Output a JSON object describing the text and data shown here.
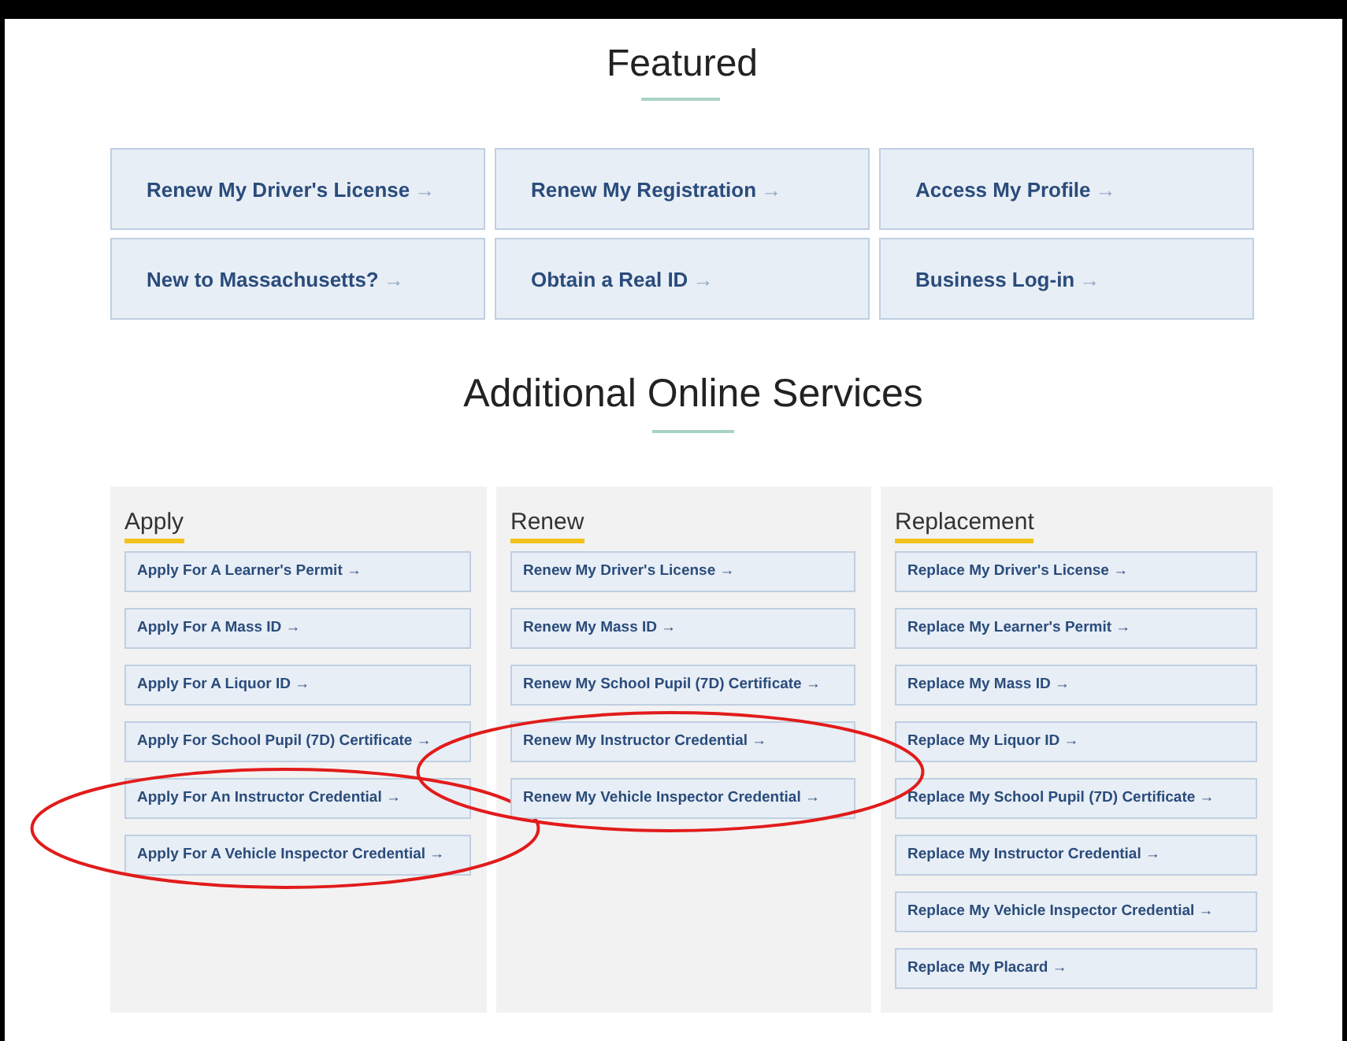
{
  "featured": {
    "title": "Featured",
    "links": [
      {
        "label": "Renew My Driver's License",
        "arrow": "→"
      },
      {
        "label": "Renew My Registration",
        "arrow": "→"
      },
      {
        "label": "Access My Profile",
        "arrow": "→"
      },
      {
        "label": "New to Massachusetts?",
        "arrow": "→"
      },
      {
        "label": "Obtain a Real ID",
        "arrow": "→"
      },
      {
        "label": "Business Log-in",
        "arrow": "→"
      }
    ]
  },
  "services": {
    "title": "Additional Online Services",
    "columns": [
      {
        "heading": "Apply",
        "links": [
          {
            "label": "Apply For A Learner's Permit →",
            "circled": false
          },
          {
            "label": "Apply For A Mass ID →",
            "circled": false
          },
          {
            "label": "Apply For A Liquor ID →",
            "circled": false
          },
          {
            "label": "Apply For School Pupil (7D) Certificate →",
            "circled": false
          },
          {
            "label": "Apply For An Instructor Credential →",
            "circled": true
          },
          {
            "label": "Apply For A Vehicle Inspector Credential →",
            "circled": true
          }
        ]
      },
      {
        "heading": "Renew",
        "links": [
          {
            "label": "Renew My Driver's License →",
            "circled": false
          },
          {
            "label": "Renew My Mass ID →",
            "circled": false
          },
          {
            "label": "Renew My School Pupil (7D) Certificate →",
            "circled": false
          },
          {
            "label": "Renew My Instructor Credential →",
            "circled": true
          },
          {
            "label": "Renew My Vehicle Inspector Credential →",
            "circled": true
          }
        ]
      },
      {
        "heading": "Replacement",
        "links": [
          {
            "label": "Replace My Driver's License →",
            "circled": false
          },
          {
            "label": "Replace My Learner's Permit →",
            "circled": false
          },
          {
            "label": "Replace My Mass ID →",
            "circled": false
          },
          {
            "label": "Replace My Liquor ID →",
            "circled": false
          },
          {
            "label": "Replace My School Pupil (7D) Certificate →",
            "circled": false
          },
          {
            "label": "Replace My Instructor Credential →",
            "circled": false
          },
          {
            "label": "Replace My Vehicle Inspector Credential →",
            "circled": false
          },
          {
            "label": "Replace My Placard →",
            "circled": false
          }
        ]
      }
    ]
  }
}
